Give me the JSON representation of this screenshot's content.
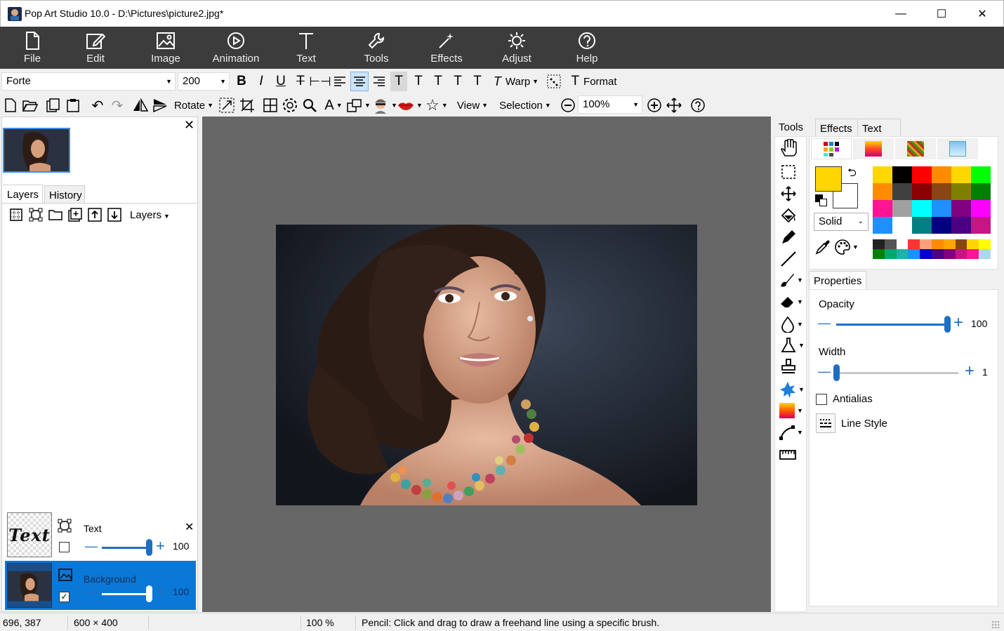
{
  "window": {
    "title": "Pop Art Studio 10.0 - D:\\Pictures\\picture2.jpg*",
    "minimize": "—",
    "maximize": "☐",
    "close": "✕"
  },
  "ribbon": [
    {
      "label": "File",
      "icon": "file-icon"
    },
    {
      "label": "Edit",
      "icon": "edit-icon"
    },
    {
      "label": "Image",
      "icon": "image-icon"
    },
    {
      "label": "Animation",
      "icon": "animation-icon"
    },
    {
      "label": "Text",
      "icon": "text-icon"
    },
    {
      "label": "Tools",
      "icon": "tools-icon"
    },
    {
      "label": "Effects",
      "icon": "effects-icon"
    },
    {
      "label": "Adjust",
      "icon": "adjust-icon"
    },
    {
      "label": "Help",
      "icon": "help-icon"
    }
  ],
  "text_toolbar": {
    "font": "Forte",
    "size": "200",
    "warp_label": "Warp",
    "format_label": "Format"
  },
  "main_toolbar": {
    "rotate_label": "Rotate",
    "view_label": "View",
    "selection_label": "Selection",
    "zoom": "100%"
  },
  "left_panel": {
    "tabs": [
      "Layers",
      "History"
    ],
    "layers_menu_label": "Layers",
    "layers": [
      {
        "name": "Text",
        "opacity": "100",
        "thumb_text": "Text",
        "visible": false,
        "selected": false,
        "opacity_fraction": 1.0
      },
      {
        "name": "Background",
        "opacity": "100",
        "visible": true,
        "selected": true,
        "opacity_fraction": 1.0
      }
    ]
  },
  "right_panel": {
    "tabs": [
      "Tools",
      "Effects",
      "Text Art"
    ],
    "fill_style": "Solid",
    "primary_color": "#ffd700",
    "secondary_color": "#ffffff",
    "properties_tab": "Properties",
    "opacity_label": "Opacity",
    "opacity_value": "100",
    "opacity_fraction": 1.0,
    "width_label": "Width",
    "width_value": "1",
    "width_fraction": 0.0,
    "antialias_label": "Antialias",
    "antialias_checked": false,
    "line_style_label": "Line Style",
    "palette": [
      "#ffd700",
      "#000000",
      "#ff0000",
      "#ff8c00",
      "#ffd700",
      "#00ff00",
      "#ff8c00",
      "#404040",
      "#8b0000",
      "#8b4513",
      "#808000",
      "#008000",
      "#ff1493",
      "#a0a0a0",
      "#00ffff",
      "#1e90ff",
      "#800080",
      "#ff00ff",
      "#1e90ff",
      "#ffffff",
      "#008080",
      "#000080",
      "#4b0082",
      "#c71585"
    ],
    "mini_palette": [
      "#222222",
      "#555555",
      "#ffffff",
      "#ff3333",
      "#ffa07a",
      "#ff8c00",
      "#ffa500",
      "#8b4513",
      "#ffd700",
      "#ffff00",
      "#008000",
      "#00a86b",
      "#20b2aa",
      "#1e90ff",
      "#0000cd",
      "#4b0082",
      "#800080",
      "#c71585",
      "#ff1493",
      "#add8e6"
    ]
  },
  "status": {
    "coords": "696, 387",
    "dimensions": "600 × 400",
    "zoom": "100 %",
    "hint": "Pencil: Click and drag to draw a freehand line using a specific brush."
  }
}
